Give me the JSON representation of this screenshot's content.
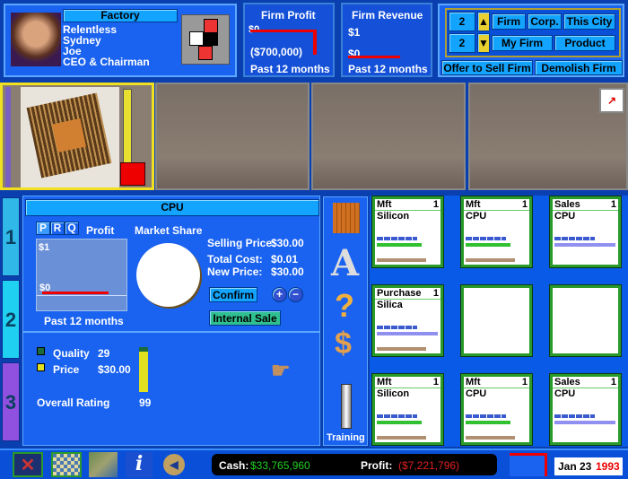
{
  "header": {
    "building_type": "Factory",
    "firm_name": "Relentless",
    "city": "Sydney",
    "manager_name": "Joe",
    "manager_title": "CEO & Chairman",
    "firm_profit": {
      "title": "Firm Profit",
      "top_label": "$0",
      "bottom_label": "($700,000)",
      "period": "Past 12 months"
    },
    "firm_revenue": {
      "title": "Firm Revenue",
      "top_label": "$1",
      "bottom_label": "$0",
      "period": "Past 12 months"
    },
    "selector": {
      "row1_value": "2",
      "row2_value": "2",
      "firm": "Firm",
      "corp": "Corp.",
      "this_city": "This City",
      "my_firm": "My Firm",
      "product": "Product"
    },
    "offer_to_sell": "Offer to Sell Firm",
    "demolish": "Demolish Firm"
  },
  "product_panel": {
    "title": "CPU",
    "prq": [
      "P",
      "R",
      "Q"
    ],
    "chart_title": "Profit",
    "chart_top": "$1",
    "chart_zero": "$0",
    "period": "Past 12 months",
    "market_share_label": "Market Share",
    "selling_price_label": "Selling Price:",
    "selling_price": "$30.00",
    "total_cost_label": "Total Cost:",
    "total_cost": "$0.01",
    "new_price_label": "New Price:",
    "new_price": "$30.00",
    "confirm": "Confirm",
    "internal_sale": "Internal Sale",
    "quality_label": "Quality",
    "quality": "29",
    "price_label": "Price",
    "price": "$30.00",
    "overall_rating_label": "Overall Rating",
    "overall_rating": "99",
    "rating_percent": 99,
    "quality_color": "#1a6a3a",
    "price_color": "#e0e020"
  },
  "tabs": [
    "1",
    "2",
    "3"
  ],
  "tools": {
    "training": "Training"
  },
  "units": [
    {
      "type": "Mft",
      "level": "1",
      "product": "Silicon"
    },
    {
      "type": "Mft",
      "level": "1",
      "product": "CPU"
    },
    {
      "type": "Sales",
      "level": "1",
      "product": "CPU"
    },
    {
      "type": "Purchase",
      "level": "1",
      "product": "Silica"
    },
    {
      "type": "",
      "level": "",
      "product": ""
    },
    {
      "type": "",
      "level": "",
      "product": ""
    },
    {
      "type": "Mft",
      "level": "1",
      "product": "Silicon"
    },
    {
      "type": "Mft",
      "level": "1",
      "product": "CPU"
    },
    {
      "type": "Sales",
      "level": "1",
      "product": "CPU"
    }
  ],
  "status": {
    "cash_label": "Cash:",
    "cash": "$33,765,960",
    "profit_label": "Profit:",
    "profit": "($7,221,796)",
    "date": "Jan 23",
    "year": "1993",
    "cash_color": "#20d020",
    "profit_color": "#e02020"
  }
}
